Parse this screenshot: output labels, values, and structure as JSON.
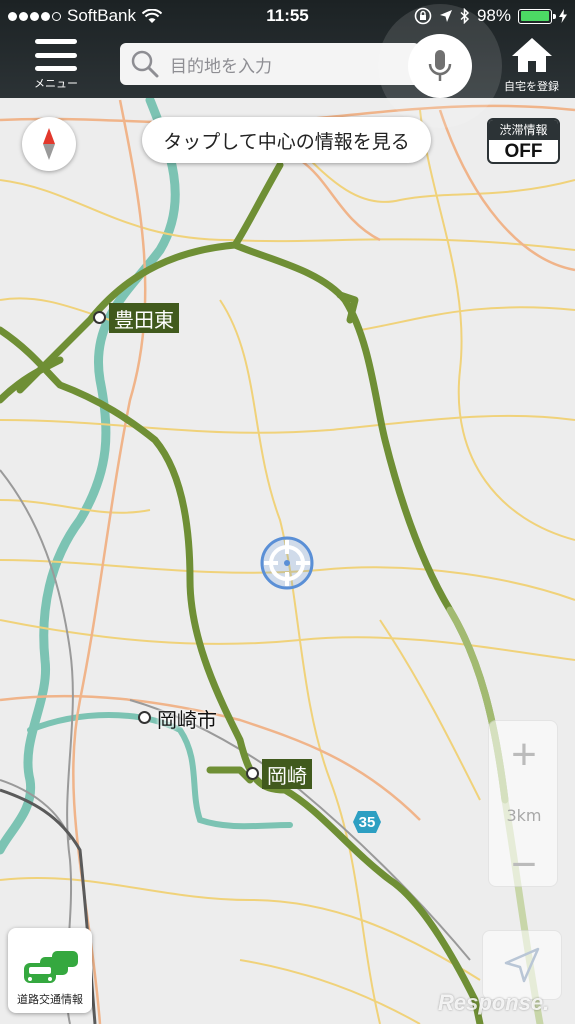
{
  "status_bar": {
    "carrier": "SoftBank",
    "time": "11:55",
    "battery": "98%",
    "battery_level": 0.98,
    "signal_bars": 4
  },
  "header": {
    "menu_label": "メニュー",
    "search_placeholder": "目的地を入力",
    "home_label": "自宅を登録"
  },
  "map_controls": {
    "center_info_label": "タップして中心の情報を見る",
    "traffic_title": "渋滞情報",
    "traffic_state": "OFF",
    "zoom_in": "+",
    "zoom_out": "−",
    "scale": "3km",
    "road_traffic_label": "道路交通情報"
  },
  "map_labels": {
    "toyota_higashi": "豊田東",
    "okazaki_shi": "岡崎市",
    "okazaki": "岡崎",
    "route_number": "35"
  },
  "watermark": "Response.",
  "colors": {
    "header_bg": "#2c3336",
    "expressway": "#6f8f35",
    "label_dark": "#415a1d",
    "river": "#7cc3b3",
    "road_yellow": "#f0d27a",
    "road_orange": "#f0b48a",
    "route_shield": "#2d9fc2",
    "battery": "#4cd964"
  }
}
